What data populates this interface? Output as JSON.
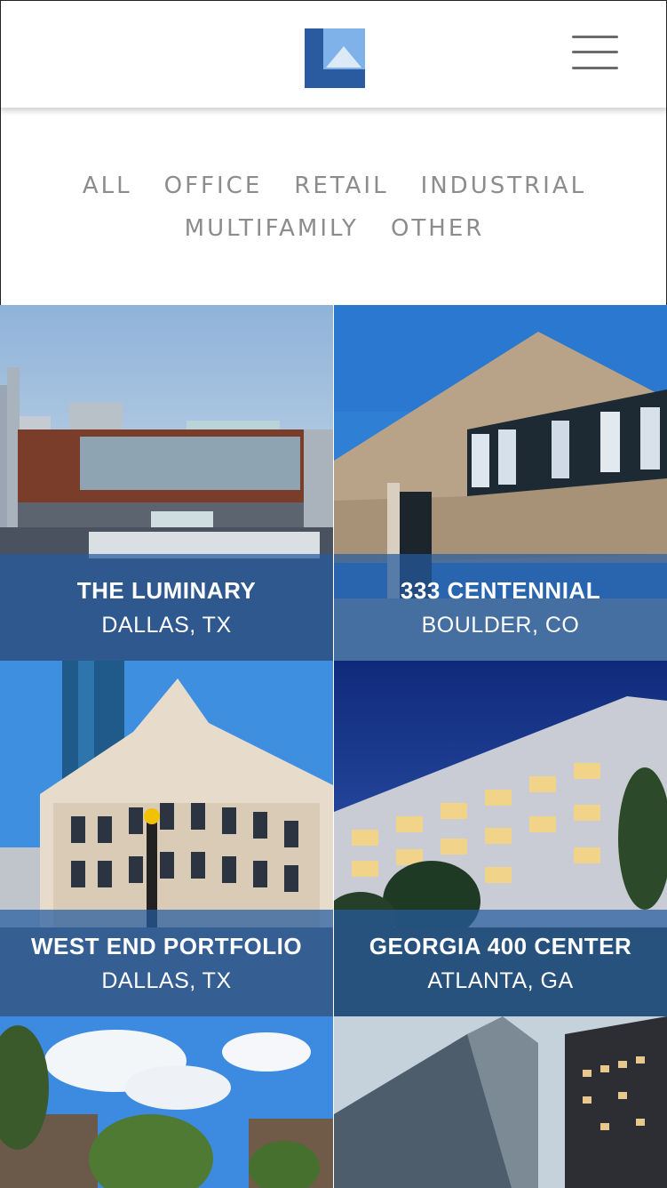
{
  "header": {
    "logo_icon": "company-logo",
    "menu_icon": "hamburger-menu-icon",
    "brand_colors": {
      "dark_blue": "#2a5aa0",
      "light_blue": "#7fb2e8"
    }
  },
  "filters": {
    "row1": [
      "ALL",
      "OFFICE",
      "RETAIL",
      "INDUSTRIAL"
    ],
    "row2": [
      "MULTIFAMILY",
      "OTHER"
    ]
  },
  "properties": [
    {
      "name": "THE LUMINARY",
      "location": "DALLAS, TX"
    },
    {
      "name": "333 CENTENNIAL",
      "location": "BOULDER, CO"
    },
    {
      "name": "WEST END PORTFOLIO",
      "location": "DALLAS, TX"
    },
    {
      "name": "GEORGIA 400 CENTER",
      "location": "ATLANTA, GA"
    }
  ],
  "colors": {
    "caption_overlay": "#265ca0",
    "filter_text": "#8c8c8c"
  }
}
